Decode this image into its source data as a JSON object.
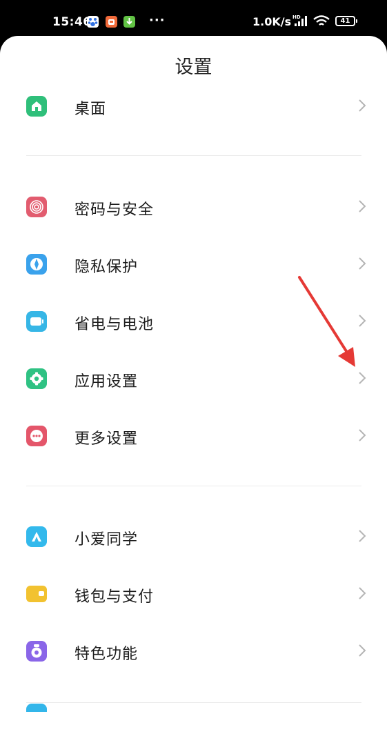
{
  "status_bar": {
    "time": "15:46",
    "dots": "···",
    "network_speed": "1.0K/s",
    "signal_tag": "HD",
    "battery_level": "41"
  },
  "page": {
    "title": "设置"
  },
  "items": [
    {
      "label": "桌面",
      "icon": "home-icon",
      "color": "#2fbf7a"
    },
    {
      "label": "密码与安全",
      "icon": "fingerprint-icon",
      "color": "#e25c6f"
    },
    {
      "label": "隐私保护",
      "icon": "privacy-compass-icon",
      "color": "#3aa2ec"
    },
    {
      "label": "省电与电池",
      "icon": "battery-icon",
      "color": "#36b6e6"
    },
    {
      "label": "应用设置",
      "icon": "gear-icon",
      "color": "#2fc283"
    },
    {
      "label": "更多设置",
      "icon": "more-dots-icon",
      "color": "#e4566a"
    },
    {
      "label": "小爱同学",
      "icon": "xiaoai-icon",
      "color": "#33b9ec"
    },
    {
      "label": "钱包与支付",
      "icon": "wallet-icon",
      "color": "#f2c230"
    },
    {
      "label": "特色功能",
      "icon": "special-feature-icon",
      "color": "#8a66e8"
    }
  ],
  "annotation_color": "#e53935"
}
